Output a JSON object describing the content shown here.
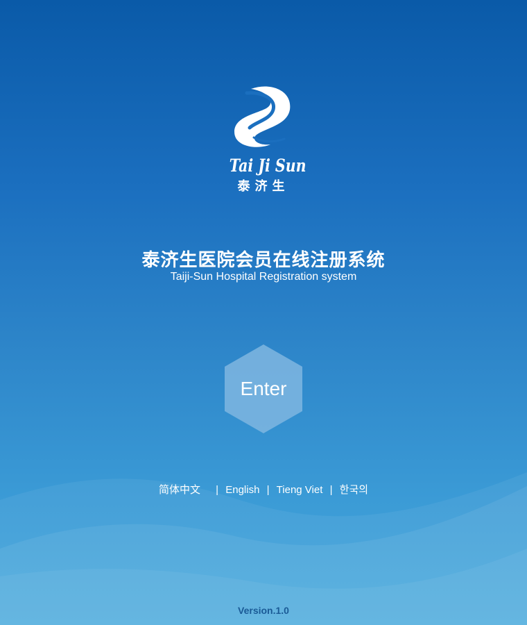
{
  "logo": {
    "latin_text": "Tai Ji Sun",
    "cjk_text": "泰济生",
    "icon": "swirl-logo-icon"
  },
  "title": {
    "chinese": "泰济生医院会员在线注册系统",
    "english": "Taiji-Sun Hospital Registration system"
  },
  "enter_button": {
    "label": "Enter",
    "fill": "#7fb6e0"
  },
  "languages": [
    {
      "label": "简体中文"
    },
    {
      "label": "English"
    },
    {
      "label": "Tieng Viet"
    },
    {
      "label": "한국의"
    }
  ],
  "separator": "|",
  "version": "Version.1.0",
  "colors": {
    "background_top": "#0a5aa8",
    "background_bottom": "#45a8dc",
    "version_text": "#1a5a96"
  }
}
